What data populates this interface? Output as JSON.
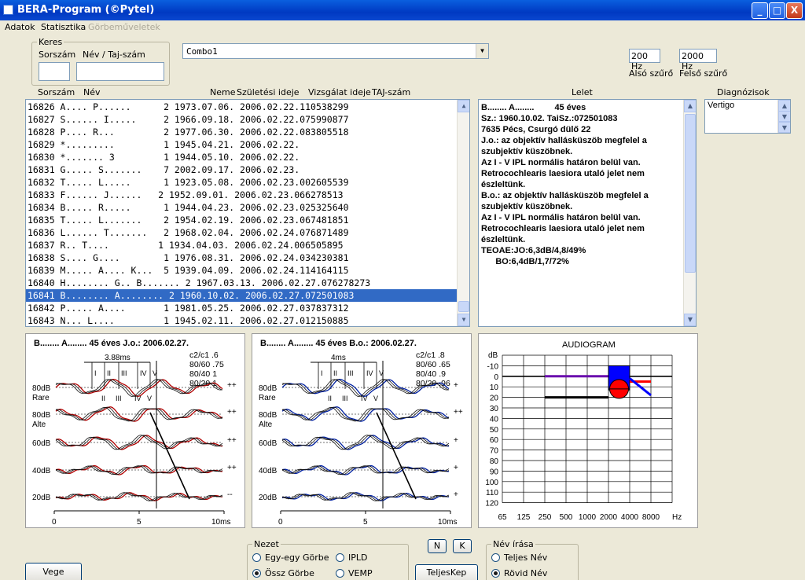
{
  "window": {
    "title": "BERA-Program (©Pytel)",
    "min": "_",
    "max": "□",
    "close": "X"
  },
  "menu": {
    "adatok": "Adatok",
    "statisztika": "Statisztika",
    "gorbe": "Görbeműveletek"
  },
  "search": {
    "group_label": "Keres",
    "sorszam_label": "Sorszám",
    "nev_label": "Név / Taj-szám",
    "sorszam_value": "",
    "nev_value": ""
  },
  "combo": {
    "value": "Combo1"
  },
  "filters": {
    "also_value": "200 Hz",
    "felso_value": "2000 Hz",
    "also_label": "Alsó szűrő",
    "felso_label": "Felső szűrő"
  },
  "columns": {
    "sorszam": "Sorszám",
    "nev": "Név",
    "neme": "Neme",
    "szul": "Születési ideje",
    "vizsg": "Vizsgálat ideje",
    "taj": "TAJ-szám",
    "lelet": "Lelet",
    "diag": "Diagnózisok"
  },
  "patients": [
    {
      "text": "16826 A.... P......      2 1973.07.06. 2006.02.22.110538299"
    },
    {
      "text": "16827 S...... I.....     2 1966.09.18. 2006.02.22.075990877"
    },
    {
      "text": "16828 P.... R...         2 1977.06.30. 2006.02.22.083805518"
    },
    {
      "text": "16829 *.........         1 1945.04.21. 2006.02.22."
    },
    {
      "text": "16830 *....... 3         1 1944.05.10. 2006.02.22."
    },
    {
      "text": "16831 G..... S.......    7 2002.09.17. 2006.02.23."
    },
    {
      "text": "16832 T..... L.....      1 1923.05.08. 2006.02.23.002605539"
    },
    {
      "text": "16833 F...... J......   2 1952.09.01. 2006.02.23.066278513"
    },
    {
      "text": "16834 B..... R.....      1 1944.04.23. 2006.02.23.025325640"
    },
    {
      "text": "16835 T..... L.......    2 1954.02.19. 2006.02.23.067481851"
    },
    {
      "text": "16836 L...... T.......   2 1968.02.04. 2006.02.24.076871489"
    },
    {
      "text": "16837 R.. T....         1 1934.04.03. 2006.02.24.006505895"
    },
    {
      "text": "16838 S.... G....        1 1976.08.31. 2006.02.24.034230381"
    },
    {
      "text": "16839 M..... A.... K...  5 1939.04.09. 2006.02.24.114164115"
    },
    {
      "text": "16840 H........ G.. B....... 2 1967.03.13. 2006.02.27.076278273"
    },
    {
      "text": "16841 B........ A........ 2 1960.10.02. 2006.02.27.072501083",
      "selected": true
    },
    {
      "text": "16842 P..... A....       1 1981.05.25. 2006.02.27.037837312"
    },
    {
      "text": "16843 N... L....         1 1945.02.11. 2006.02.27.012150885"
    }
  ],
  "lelet": {
    "header_name": "B........ A........",
    "header_age": "45 éves",
    "lines": [
      "",
      "Sz.: 1960.10.02. TaiSz.:072501083",
      "7635 Pécs, Csurgó dülő 22",
      "",
      "J.o.: az objektív hallásküszöb megfelel a",
      "szubjektív küszöbnek.",
      "Az I - V IPL normális határon belül van.",
      "Retrocochlearis laesiora utaló jelet nem",
      "észleltünk.",
      "",
      "B.o.: az objektív hallásküszöb megfelel a",
      "szubjektív küszöbnek.",
      "Az I - V IPL normális határon belül van.",
      "Retrocochlearis laesiora utaló jelet nem",
      "észleltünk.",
      "",
      "TEOAE:JO:6,3dB/4,8/49%",
      "      BO:6,4dB/1,7/72%"
    ]
  },
  "diagnoses": [
    "Vertigo"
  ],
  "graph_left": {
    "title": "B........ A........  45 éves J.o.:  2006.02.27.",
    "latency": "3.88ms",
    "stats": [
      "c2/c1  .6",
      "80/60  .75",
      "80/40  1",
      "80/20  1"
    ],
    "levels": [
      "80dB",
      "80dB",
      "60dB",
      "40dB",
      "20dB"
    ],
    "sub": [
      "Rare",
      "Alte"
    ],
    "marks": [
      "++",
      "++",
      "++",
      "++",
      "--"
    ],
    "waves_top": [
      "I",
      "II",
      "III",
      "IV",
      "V"
    ],
    "waves_mid": [
      "II",
      "III",
      "IV",
      "V"
    ],
    "xticks": [
      "0",
      "5",
      "10ms"
    ]
  },
  "graph_right": {
    "title": "B........ A........  45 éves B.o.:  2006.02.27.",
    "latency": "4ms",
    "stats": [
      "c2/c1  .8",
      "80/60  .65",
      "80/40  .9",
      "80/20  .96"
    ],
    "levels": [
      "80dB",
      "80dB",
      "60dB",
      "40dB",
      "20dB"
    ],
    "sub": [
      "Rare",
      "Alte"
    ],
    "marks": [
      "+",
      "++",
      "+",
      "+",
      "+"
    ],
    "waves_top": [
      "I",
      "II",
      "III",
      "IV",
      "V"
    ],
    "waves_mid": [
      "II",
      "III",
      "IV",
      "V"
    ],
    "xticks": [
      "0",
      "5",
      "10ms"
    ]
  },
  "audiogram": {
    "title": "AUDIOGRAM",
    "dB_label": "dB",
    "y_ticks": [
      "-10",
      "0",
      "10",
      "20",
      "30",
      "40",
      "50",
      "60",
      "70",
      "80",
      "90",
      "100",
      "110",
      "120"
    ],
    "x_ticks": [
      "65",
      "125",
      "250",
      "500",
      "1000",
      "2000",
      "4000",
      "8000"
    ],
    "x_unit": "Hz",
    "colors": {
      "right": "#ff0000",
      "left": "#0000ff",
      "bone": "#000000",
      "conductive": "#6a0dad"
    }
  },
  "nezet": {
    "label": "Nezet",
    "options": [
      "Egy-egy Görbe",
      "IPLD",
      "Össz Görbe",
      "VEMP"
    ],
    "selected": "Össz Görbe"
  },
  "buttons": {
    "vege": "Vege",
    "n": "N",
    "k": "K",
    "teljeskep": "TeljesKep"
  },
  "nev_irasa": {
    "label": "Név írása",
    "options": [
      "Teljes Név",
      "Rövid Név"
    ],
    "selected": "Rövid Név"
  }
}
